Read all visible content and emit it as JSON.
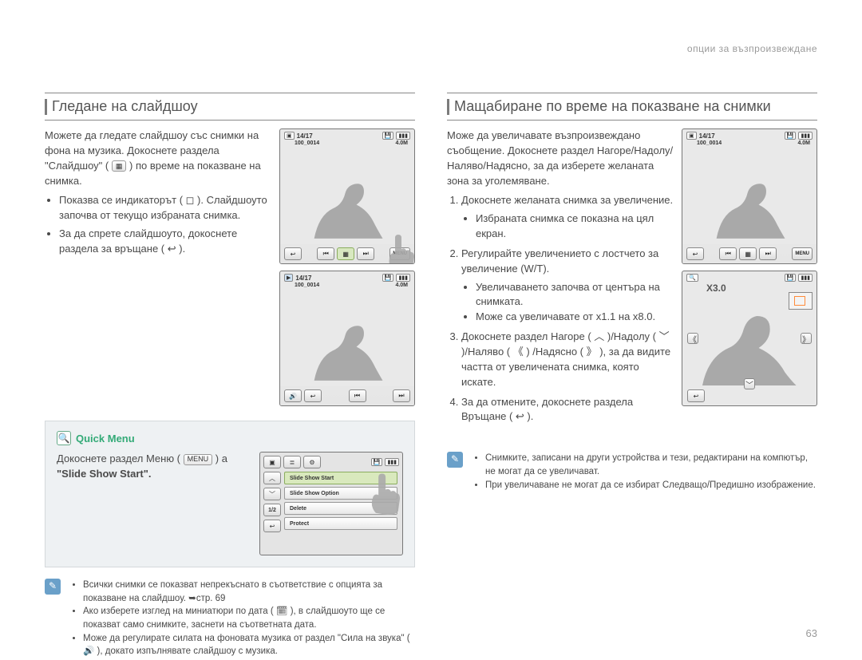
{
  "topRight": "опции за възпроизвеждане",
  "pageNumber": "63",
  "left": {
    "heading": "Гледане на слайдшоу",
    "intro1": "Можете да гледате слайдшоу със снимки на фона на музика. Докоснете раздела \"Слайдшоу\" (",
    "intro2": ") по време на показване на снимка.",
    "bullets": [
      "Показва се индикаторът ( ◻ ). Слайдшоуто започва от текущо избраната снимка.",
      "За да спрете слайдшоуто, докоснете раздела за връщане ( ↩ )."
    ],
    "screen": {
      "photoIndex": "14/17",
      "folder": "100_0014",
      "size": "4.0M",
      "menu": "MENU"
    },
    "quickMenu": {
      "title": "Quick Menu",
      "line1a": "Докоснете раздел Меню (",
      "line1b": ") a",
      "line2": "\"Slide Show Start\".",
      "menuLabel": "MENU",
      "items": [
        "Slide Show Start",
        "Slide Show Option",
        "Delete",
        "Protect"
      ],
      "page": "1/2"
    },
    "notes": [
      "Всички снимки се показват непрекъснато в съответствие с опцията за показване на слайдшоу. ➥стр. 69",
      "Ако изберете изглед на миниатюри по дата ( 🗓 ), в слайдшоуто ще се показват само снимките, заснети на съответната дата.",
      "Може да регулирате силата на фоновата музика от раздел \"Сила на звука\" ( 🔊 ), докато изпълнявате слайдшоу с музика."
    ]
  },
  "right": {
    "heading": "Мащабиране по време на показване на снимки",
    "intro": "Може да увеличавате възпроизвеждано съобщение. Докоснете раздел Нагоре/Надолу/Наляво/Надясно, за да изберете желаната зона за уголемяване.",
    "steps": {
      "s1": "Докоснете желаната снимка за увеличение.",
      "s1a": "Избраната снимка се показна на цял екран.",
      "s2": "Регулирайте увеличението с лостчето за увеличение (W/T).",
      "s2a": "Увеличаването започва от центъра на снимката.",
      "s2b": "Може са увеличавате от x1.1 на x8.0.",
      "s3": "Докоснете раздел Нагоре ( ︿ )/Надолу ( ﹀ )/Наляво ( 《 ) /Надясно ( 》 ), за да видите частта от увеличената снимка, която искате.",
      "s4": "За да отмените, докоснете раздела Връщане ( ↩ )."
    },
    "screen": {
      "photoIndex": "14/17",
      "folder": "100_0014",
      "size": "4.0M",
      "menu": "MENU",
      "zoom": "X3.0"
    },
    "notes": [
      "Снимките, записани на други устройства и тези, редактирани на компютър, не могат да се увеличават.",
      "При увеличаване не могат да се избират Следващо/Предишно изображение."
    ]
  }
}
